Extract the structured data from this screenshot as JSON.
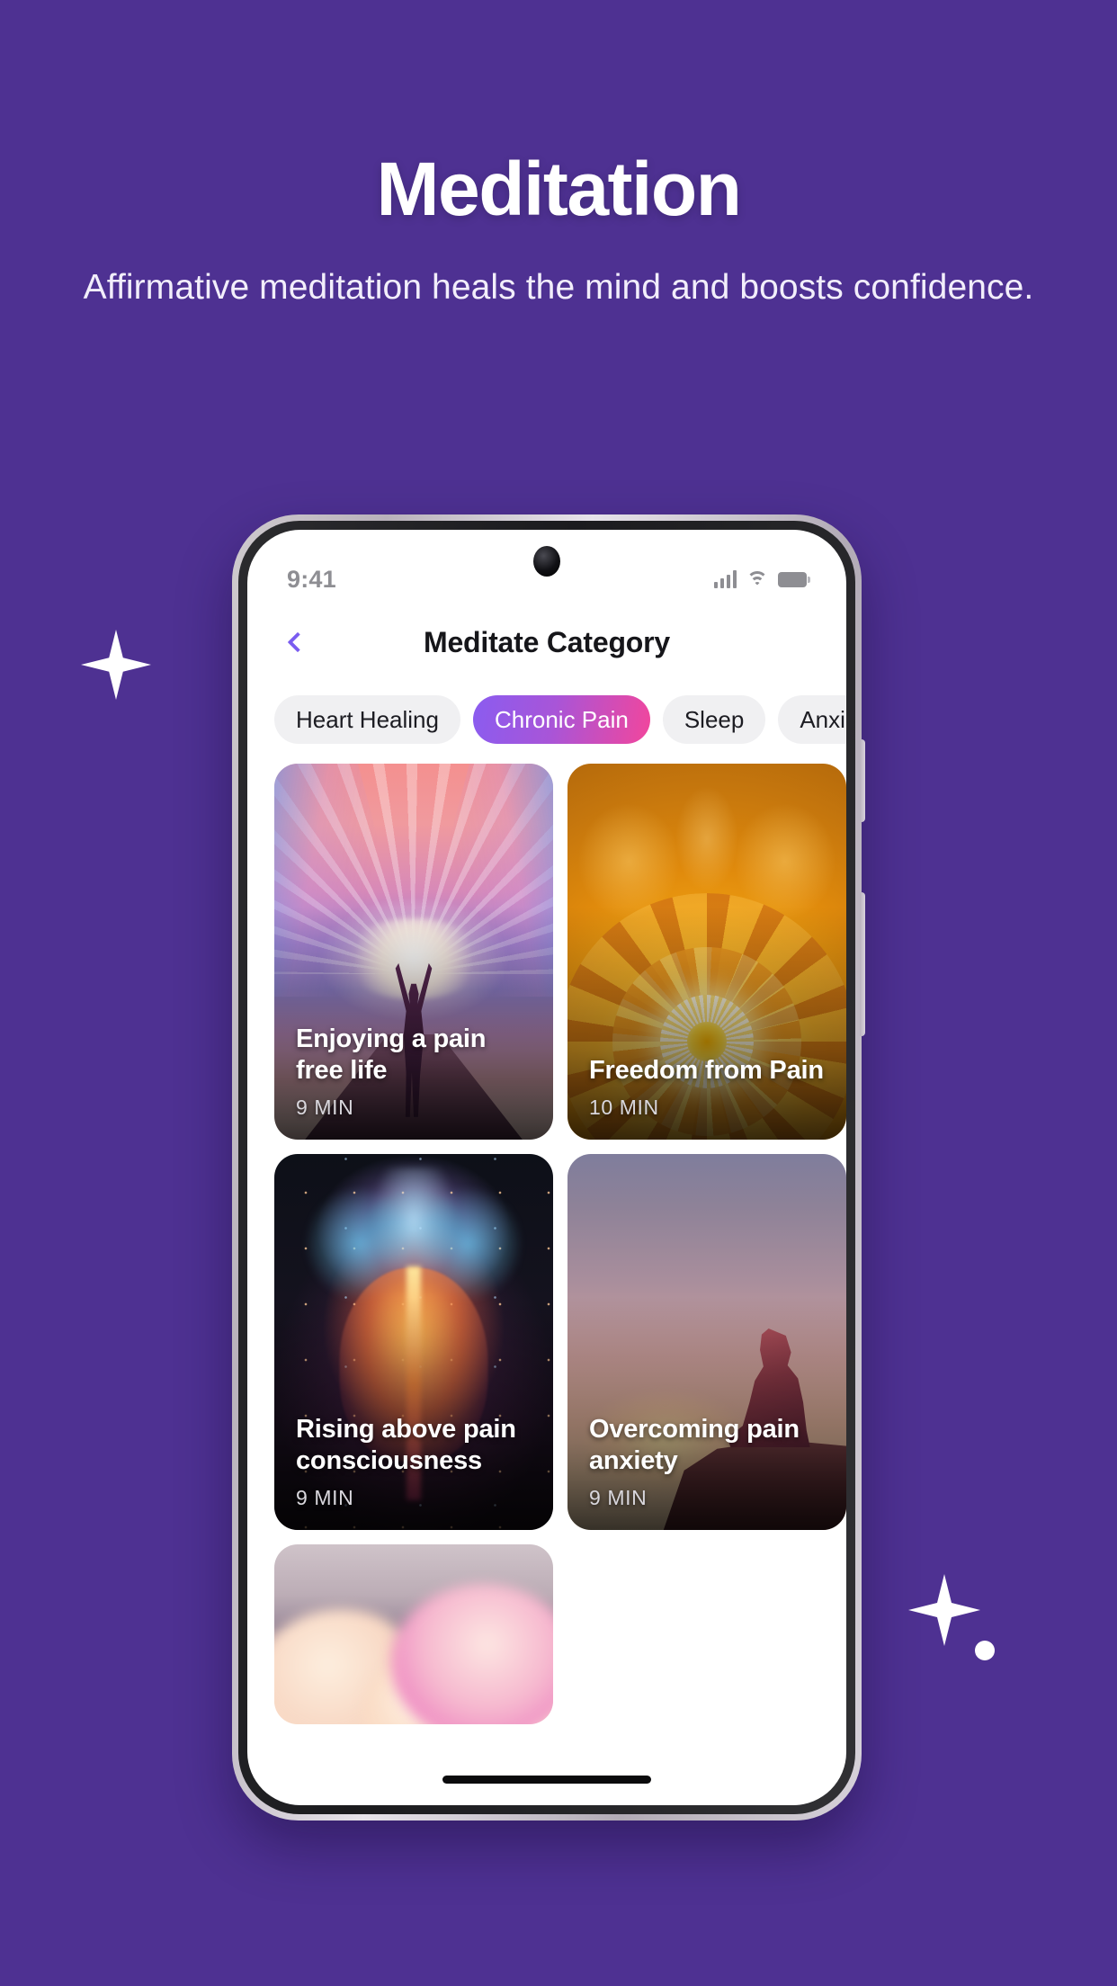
{
  "hero": {
    "title": "Meditation",
    "subtitle": "Affirmative meditation heals the mind and boosts confidence."
  },
  "theme": {
    "background": "#4e3192",
    "accent": "#7a5cf0",
    "chip_gradient_start": "#8a5cf0",
    "chip_gradient_end": "#f2469c",
    "chip_inactive_bg": "#f0f0f2",
    "card_title_color": "#ffffff",
    "duration_color": "#d9d7dd"
  },
  "phone": {
    "statusbar": {
      "time": "9:41",
      "signal_icon": "cellular-signal-icon",
      "wifi_icon": "wifi-icon",
      "battery_icon": "battery-icon",
      "camera": "front-camera"
    },
    "navbar": {
      "back_icon": "chevron-left-icon",
      "title": "Meditate Category"
    },
    "chips": [
      {
        "label": "Heart Healing",
        "active": false
      },
      {
        "label": "Chronic Pain",
        "active": true
      },
      {
        "label": "Sleep",
        "active": false
      },
      {
        "label": "Anxiety",
        "active": false
      }
    ],
    "cards": [
      {
        "title": "Enjoying a pain free life",
        "duration": "9 MIN",
        "art": "sunrise-figure-artwork"
      },
      {
        "title": "Freedom from Pain",
        "duration": "10 MIN",
        "art": "golden-lotus-mandala-artwork"
      },
      {
        "title": "Rising above pain consciousness",
        "duration": "9 MIN",
        "art": "cosmic-nebula-figure-artwork"
      },
      {
        "title": "Overcoming pain anxiety",
        "duration": "9 MIN",
        "art": "dusk-meditator-artwork"
      },
      {
        "title": "",
        "duration": "",
        "art": "pink-clouds-artwork"
      }
    ],
    "home_indicator": "home-indicator"
  },
  "decor": {
    "sparkle_left": "sparkle-icon",
    "sparkle_right": "sparkle-icon",
    "dot_right": "dot-decoration"
  }
}
